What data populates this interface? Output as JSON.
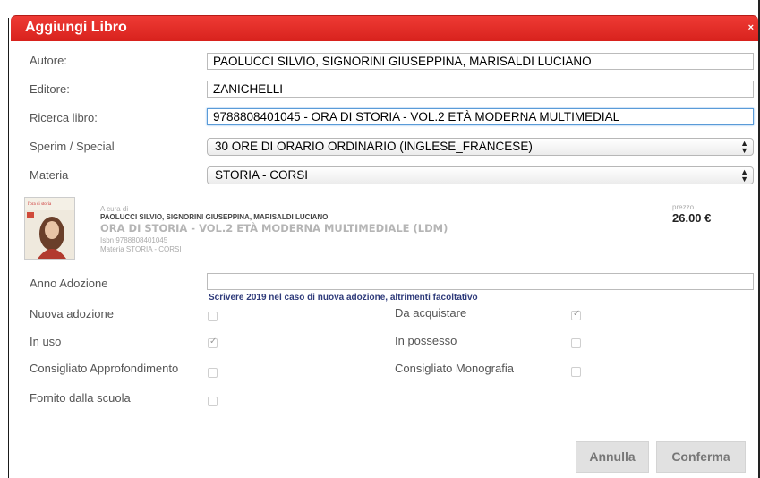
{
  "dialog": {
    "title": "Aggiungi Libro",
    "close": "×"
  },
  "form": {
    "autore_label": "Autore:",
    "autore_value": "PAOLUCCI SILVIO, SIGNORINI GIUSEPPINA, MARISALDI LUCIANO",
    "editore_label": "Editore:",
    "editore_value": "ZANICHELLI",
    "ricerca_label": "Ricerca libro:",
    "ricerca_value": "9788808401045 - ORA DI STORIA - VOL.2 ETÀ MODERNA MULTIMEDIAL",
    "sperim_label": "Sperim / Special",
    "sperim_value": "30 ORE DI ORARIO ORDINARIO (INGLESE_FRANCESE)",
    "materia_label": "Materia",
    "materia_value": "STORIA - CORSI"
  },
  "book": {
    "cover_title": "l'ora di storia",
    "a_cura_di": "A cura di",
    "authors": "PAOLUCCI SILVIO, SIGNORINI GIUSEPPINA, MARISALDI LUCIANO",
    "title": "ORA DI STORIA - VOL.2 ETÀ MODERNA MULTIMEDIALE (LDM)",
    "isbn": "Isbn 9788808401045",
    "materia": "Materia STORIA - CORSI",
    "prezzo_label": "prezzo",
    "prezzo_value": "26.00 €"
  },
  "adozione": {
    "anno_label": "Anno Adozione",
    "anno_value": "",
    "hint": "Scrivere 2019 nel caso di nuova adozione, altrimenti facoltativo"
  },
  "checkboxes": [
    {
      "label": "Nuova adozione",
      "checked": false
    },
    {
      "label": "Da acquistare",
      "checked": true
    },
    {
      "label": "In uso",
      "checked": true
    },
    {
      "label": "In possesso",
      "checked": false
    },
    {
      "label": "Consigliato Approfondimento",
      "checked": false
    },
    {
      "label": "Consigliato Monografia",
      "checked": false
    },
    {
      "label": "Fornito dalla scuola",
      "checked": false
    }
  ],
  "buttons": {
    "annulla": "Annulla",
    "conferma": "Conferma"
  },
  "colors": {
    "titlebar": "#e02a25",
    "focus_border": "#5a9bd8",
    "hint_text": "#2e3a7a"
  }
}
